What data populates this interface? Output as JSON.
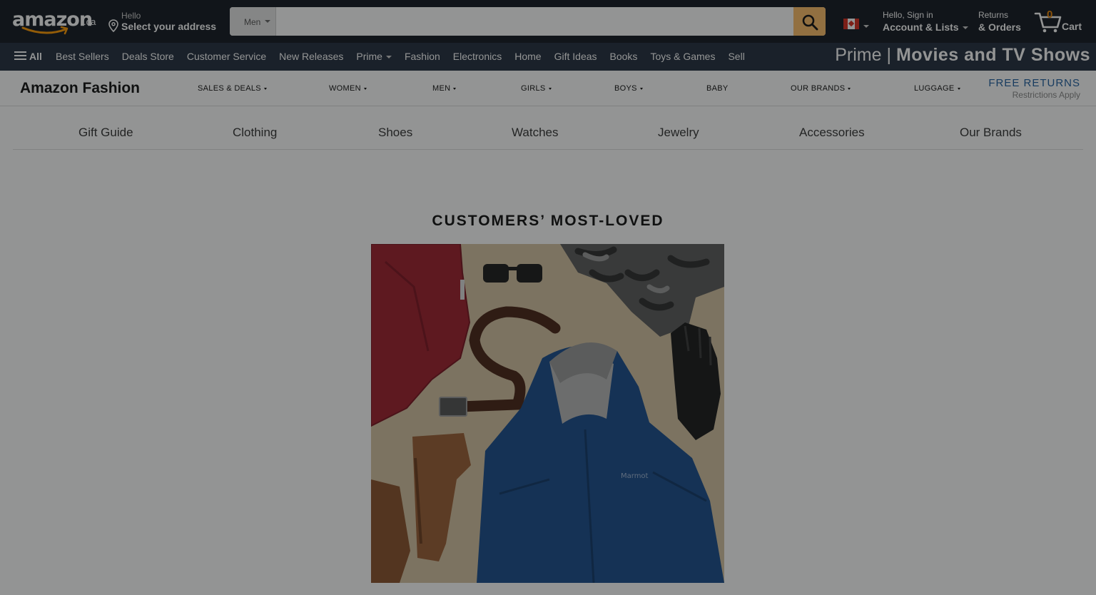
{
  "header": {
    "logo_text": "amazon",
    "logo_tld": ".ca",
    "address_line1": "Hello",
    "address_line2": "Select your address",
    "search_category": "Men",
    "search_placeholder": "",
    "flag": "canada-flag",
    "account_line1": "Hello, Sign in",
    "account_line2": "Account & Lists",
    "returns_line1": "Returns",
    "returns_line2": "& Orders",
    "cart_count": "0",
    "cart_label": "Cart"
  },
  "nav": {
    "all_label": "All",
    "links": [
      "Best Sellers",
      "Deals Store",
      "Customer Service",
      "New Releases",
      "Prime",
      "Fashion",
      "Electronics",
      "Home",
      "Gift Ideas",
      "Books",
      "Toys & Games",
      "Sell"
    ],
    "promo_prefix": "Prime |",
    "promo_bold": "Movies and TV Shows"
  },
  "fashion_nav": {
    "brand": "Amazon Fashion",
    "items": [
      "SALES & DEALS",
      "WOMEN",
      "MEN",
      "GIRLS",
      "BOYS",
      "BABY",
      "OUR BRANDS",
      "LUGGAGE"
    ],
    "free_returns": "FREE RETURNS",
    "restrictions": "Restrictions Apply"
  },
  "categories": [
    "Gift Guide",
    "Clothing",
    "Shoes",
    "Watches",
    "Jewelry",
    "Accessories",
    "Our Brands"
  ],
  "hero": {
    "title": "CUSTOMERS’ MOST-LOVED",
    "image_label": "Marmot"
  },
  "colors": {
    "header_bg": "#131921",
    "nav_bg": "#232f3e",
    "search_button": "#febd69",
    "cart_count": "#f08804",
    "free_returns": "#1f5fa0"
  }
}
